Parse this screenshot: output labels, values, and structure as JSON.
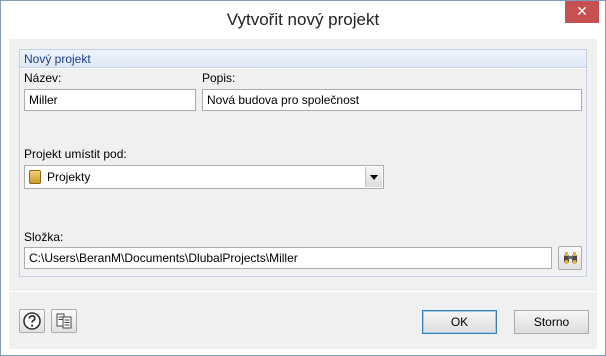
{
  "window": {
    "title": "Vytvořit nový projekt",
    "close_glyph": "✕"
  },
  "group": {
    "title": "Nový projekt"
  },
  "fields": {
    "name_label": "Název:",
    "name_value": "Miller",
    "description_label": "Popis:",
    "description_value": "Nová budova pro společnost",
    "parent_label": "Projekt umístit pod:",
    "parent_value": "Projekty",
    "folder_label": "Složka:",
    "folder_value": "C:\\Users\\BeranM\\Documents\\DlubalProjects\\Miller"
  },
  "icons": {
    "close": "close-icon",
    "project_folder": "project-folder-icon",
    "combo_arrow": "chevron-down-icon",
    "browse": "binoculars-icon",
    "help": "help-icon",
    "copy": "copy-details-icon"
  },
  "buttons": {
    "ok_label": "OK",
    "cancel_label": "Storno"
  },
  "colors": {
    "close_button": "#c75050",
    "group_title": "#1a3d8f",
    "default_button_border": "#3c7fb1"
  }
}
